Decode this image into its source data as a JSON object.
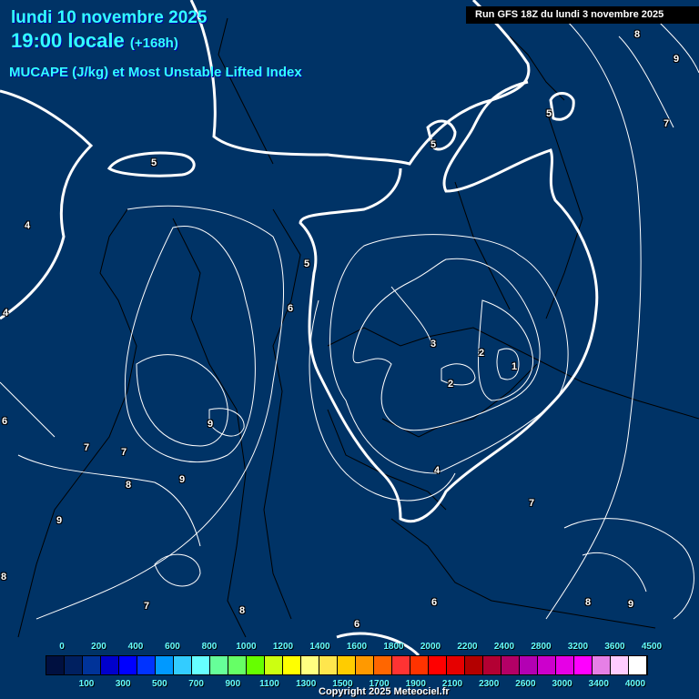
{
  "header": {
    "date": "lundi 10 novembre 2025",
    "time": "19:00 locale",
    "lead": "(+168h)",
    "parameter": "MUCAPE (J/kg) et Most Unstable Lifted Index",
    "run": "Run GFS 18Z du lundi 3 novembre 2025"
  },
  "contour_labels": [
    "8",
    "9",
    "7",
    "5",
    "5",
    "5",
    "4",
    "4",
    "5",
    "6",
    "6",
    "7",
    "7",
    "8",
    "9",
    "9",
    "9",
    "8",
    "3",
    "2",
    "2",
    "1",
    "4",
    "7",
    "8",
    "9",
    "6",
    "6",
    "7",
    "8"
  ],
  "legend": {
    "colors": [
      "#001040",
      "#002060",
      "#003399",
      "#0000cc",
      "#0000ff",
      "#0033ff",
      "#0099ff",
      "#33ccff",
      "#66ffff",
      "#66ff99",
      "#66ff66",
      "#66ff00",
      "#ccff11",
      "#ffff00",
      "#ffff80",
      "#ffe64d",
      "#ffcc00",
      "#ff9900",
      "#ff6600",
      "#ff3333",
      "#ff3300",
      "#ff0000",
      "#e60000",
      "#b30000",
      "#b30033",
      "#b30066",
      "#b300b3",
      "#cc00cc",
      "#e600e6",
      "#ff00ff",
      "#e680e6",
      "#ffccff",
      "#ffffff"
    ],
    "top_labels": [
      "0",
      "200",
      "400",
      "600",
      "800",
      "1000",
      "1200",
      "1400",
      "1600",
      "1800",
      "2000",
      "2200",
      "2400",
      "2800",
      "3200",
      "3600",
      "4500"
    ],
    "bottom_labels": [
      "100",
      "300",
      "500",
      "700",
      "900",
      "1100",
      "1300",
      "1500",
      "1700",
      "1900",
      "2100",
      "2300",
      "2600",
      "3000",
      "3400",
      "4000"
    ]
  },
  "copyright": "Copyright 2025 Meteociel.fr"
}
